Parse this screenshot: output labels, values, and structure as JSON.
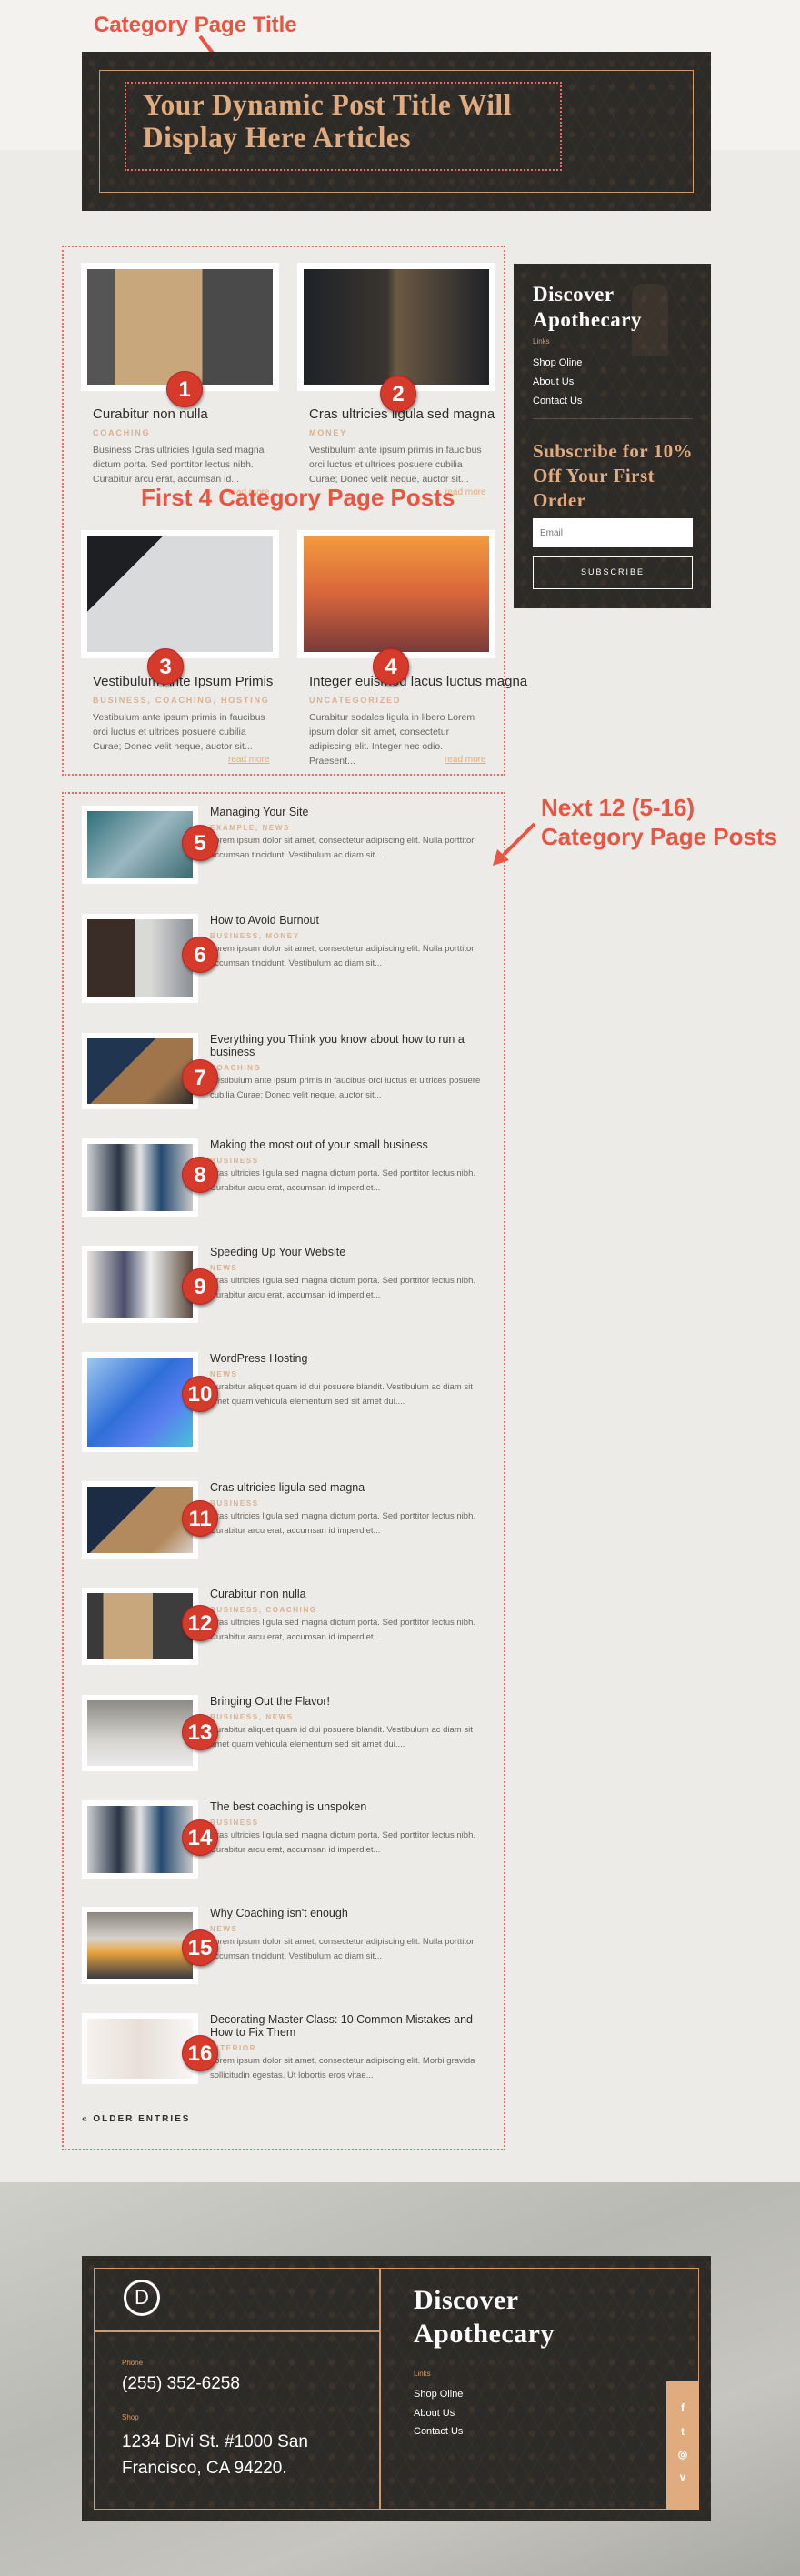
{
  "annotations": {
    "title_label": "Category Page Title",
    "first_posts_label": "First 4 Category Page Posts",
    "next_posts_line1": "Next 12 (5-16)",
    "next_posts_line2": "Category Page Posts",
    "color": "#ea5440"
  },
  "hero": {
    "title": "Your Dynamic Post Title Will Display Here Articles"
  },
  "featured_posts": [
    {
      "badge": "1",
      "title": "Curabitur non nulla",
      "category": "COACHING",
      "excerpt": "Business Cras ultricies ligula sed magna dictum porta. Sed porttitor lectus nibh. Curabitur arcu erat, accumsan id...",
      "read_more": "read more"
    },
    {
      "badge": "2",
      "title": "Cras ultricies ligula sed magna",
      "category": "MONEY",
      "excerpt": "Vestibulum ante ipsum primis in faucibus orci luctus et ultrices posuere cubilia Curae; Donec velit neque, auctor sit...",
      "read_more": "read more"
    },
    {
      "badge": "3",
      "title": "Vestibulum Ante Ipsum Primis",
      "category": "BUSINESS, COACHING, HOSTING",
      "excerpt": "Vestibulum ante ipsum primis in faucibus orci luctus et ultrices posuere cubilia Curae; Donec velit neque, auctor sit...",
      "read_more": "read more"
    },
    {
      "badge": "4",
      "title": "Integer euismod lacus luctus magna",
      "category": "UNCATEGORIZED",
      "excerpt": "Curabitur sodales ligula in libero Lorem ipsum dolor sit amet, consectetur adipiscing elit. Integer nec odio. Praesent...",
      "read_more": "read more"
    }
  ],
  "sidebar": {
    "title": "Discover Apothecary",
    "links_label": "Links",
    "links": [
      "Shop Oline",
      "About Us",
      "Contact Us"
    ],
    "subscribe_heading": "Subscribe for 10% Off Your First Order",
    "email_placeholder": "Email",
    "subscribe_button": "SUBSCRIBE"
  },
  "list_posts": [
    {
      "badge": "5",
      "title": "Managing Your Site",
      "category": "EXAMPLE, NEWS",
      "excerpt": "Lorem ipsum dolor sit amet, consectetur adipiscing elit. Nulla porttitor accumsan tincidunt. Vestibulum ac diam sit..."
    },
    {
      "badge": "6",
      "title": "How to Avoid Burnout",
      "category": "BUSINESS, MONEY",
      "excerpt": "Lorem ipsum dolor sit amet, consectetur adipiscing elit. Nulla porttitor accumsan tincidunt. Vestibulum ac diam sit..."
    },
    {
      "badge": "7",
      "title": "Everything you Think you know about how to run a business",
      "category": "COACHING",
      "excerpt": "Vestibulum ante ipsum primis in faucibus orci luctus et ultrices posuere cubilia Curae; Donec velit neque, auctor sit..."
    },
    {
      "badge": "8",
      "title": "Making the most out of your small business",
      "category": "BUSINESS",
      "excerpt": "Cras ultricies ligula sed magna dictum porta. Sed porttitor lectus nibh. Curabitur arcu erat, accumsan id imperdiet..."
    },
    {
      "badge": "9",
      "title": "Speeding Up Your Website",
      "category": "NEWS",
      "excerpt": "Cras ultricies ligula sed magna dictum porta. Sed porttitor lectus nibh. Curabitur arcu erat, accumsan id imperdiet..."
    },
    {
      "badge": "10",
      "title": "WordPress Hosting",
      "category": "NEWS",
      "excerpt": "Curabitur aliquet quam id dui posuere blandit. Vestibulum ac diam sit amet quam vehicula elementum sed sit amet dui...."
    },
    {
      "badge": "11",
      "title": "Cras ultricies ligula sed magna",
      "category": "BUSINESS",
      "excerpt": "Cras ultricies ligula sed magna dictum porta. Sed porttitor lectus nibh. Curabitur arcu erat, accumsan id imperdiet..."
    },
    {
      "badge": "12",
      "title": "Curabitur non nulla",
      "category": "BUSINESS, COACHING",
      "excerpt": "Cras ultricies ligula sed magna dictum porta. Sed porttitor lectus nibh. Curabitur arcu erat, accumsan id imperdiet..."
    },
    {
      "badge": "13",
      "title": "Bringing Out the Flavor!",
      "category": "BUSINESS, NEWS",
      "excerpt": "Curabitur aliquet quam id dui posuere blandit. Vestibulum ac diam sit amet quam vehicula elementum sed sit amet dui...."
    },
    {
      "badge": "14",
      "title": "The best coaching is unspoken",
      "category": "BUSINESS",
      "excerpt": "Cras ultricies ligula sed magna dictum porta. Sed porttitor lectus nibh. Curabitur arcu erat, accumsan id imperdiet..."
    },
    {
      "badge": "15",
      "title": "Why Coaching isn't enough",
      "category": "NEWS",
      "excerpt": "Lorem ipsum dolor sit amet, consectetur adipiscing elit. Nulla porttitor accumsan tincidunt. Vestibulum ac diam sit..."
    },
    {
      "badge": "16",
      "title": "Decorating Master Class: 10 Common Mistakes and How to Fix Them",
      "category": "INTERIOR",
      "excerpt": "Lorem ipsum dolor sit amet, consectetur adipiscing elit. Morbi gravida sollicitudin egestas. Ut lobortis eros vitae..."
    }
  ],
  "pagination": {
    "older_entries": "« OLDER ENTRIES"
  },
  "footer": {
    "logo_letter": "D",
    "phone_label": "Phone",
    "phone": "(255) 352-6258",
    "shop_label": "Shop",
    "address": "1234 Divi St. #1000 San Francisco, CA 94220.",
    "title": "Discover Apothecary",
    "links_label": "Links",
    "links": [
      "Shop Oline",
      "About Us",
      "Contact Us"
    ],
    "social_icons": [
      "facebook-icon",
      "twitter-icon",
      "instagram-icon",
      "vimeo-icon"
    ],
    "social_glyphs": [
      "f",
      "t",
      "◎",
      "v"
    ]
  },
  "colors": {
    "accent": "#e1ab80",
    "dark": "#2d2b28",
    "annotation": "#ea5440",
    "badge": "#d63a2a"
  }
}
